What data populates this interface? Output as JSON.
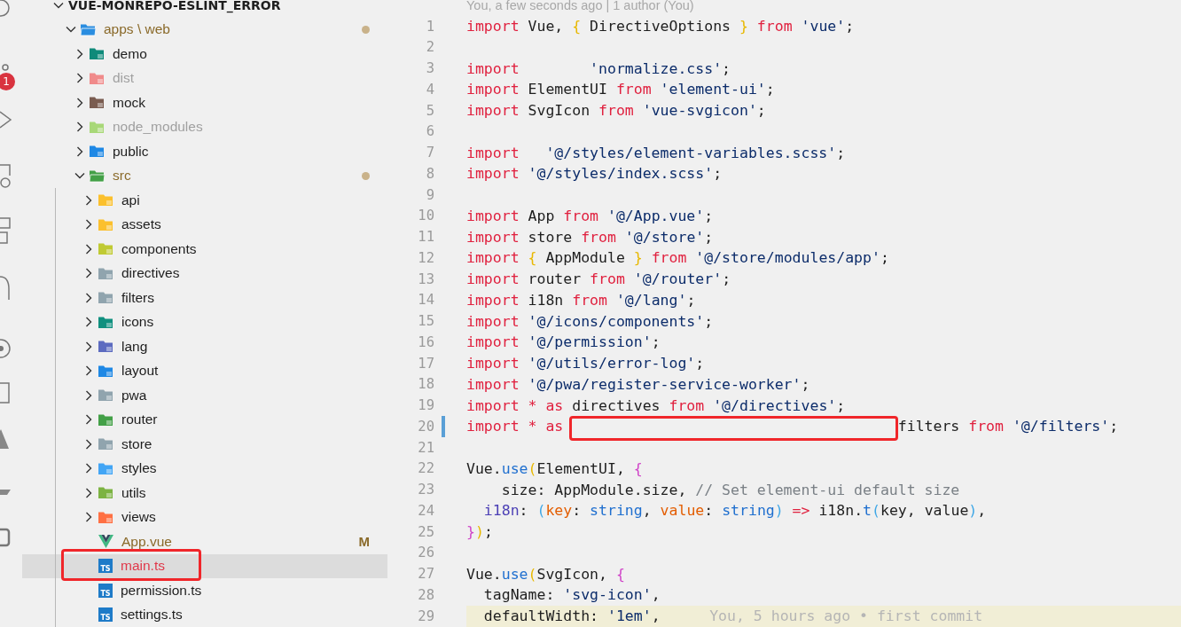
{
  "activity_bar": {
    "badge": "1"
  },
  "explorer": {
    "title": "VUE-MONREPO-ESLINT_ERROR",
    "expanded": true,
    "tree": [
      {
        "label": "apps \\ web",
        "kind": "folder",
        "color": "#2a8de0",
        "expanded": true,
        "modified": true,
        "selected": false,
        "children": [
          {
            "label": "demo",
            "kind": "folder",
            "color": "#0f8a7a",
            "expanded": false,
            "selected": false
          },
          {
            "label": "dist",
            "kind": "folder",
            "color": "#f08a8a",
            "expanded": false,
            "ignored": true,
            "selected": false
          },
          {
            "label": "mock",
            "kind": "folder",
            "color": "#7a5c50",
            "expanded": false,
            "selected": false
          },
          {
            "label": "node_modules",
            "kind": "folder",
            "color": "#a8d878",
            "expanded": false,
            "ignored": true,
            "selected": false
          },
          {
            "label": "public",
            "kind": "folder",
            "color": "#1e88e5",
            "expanded": false,
            "selected": false
          },
          {
            "label": "src",
            "kind": "folder",
            "color": "#43a047",
            "expanded": true,
            "modified": true,
            "selected": false,
            "children": [
              {
                "label": "api",
                "kind": "folder",
                "color": "#fbc02d",
                "expanded": false,
                "selected": false
              },
              {
                "label": "assets",
                "kind": "folder",
                "color": "#fbc02d",
                "expanded": false,
                "selected": false
              },
              {
                "label": "components",
                "kind": "folder",
                "color": "#c0ca33",
                "expanded": false,
                "selected": false
              },
              {
                "label": "directives",
                "kind": "folder",
                "color": "#90a4ae",
                "expanded": false,
                "selected": false
              },
              {
                "label": "filters",
                "kind": "folder",
                "color": "#90a4ae",
                "expanded": false,
                "selected": false
              },
              {
                "label": "icons",
                "kind": "folder",
                "color": "#10907f",
                "expanded": false,
                "selected": false
              },
              {
                "label": "lang",
                "kind": "folder",
                "color": "#5c6bc0",
                "expanded": false,
                "selected": false
              },
              {
                "label": "layout",
                "kind": "folder",
                "color": "#1e88e5",
                "expanded": false,
                "selected": false
              },
              {
                "label": "pwa",
                "kind": "folder",
                "color": "#90a4ae",
                "expanded": false,
                "selected": false
              },
              {
                "label": "router",
                "kind": "folder",
                "color": "#43a047",
                "expanded": false,
                "selected": false
              },
              {
                "label": "store",
                "kind": "folder",
                "color": "#90a4ae",
                "expanded": false,
                "selected": false
              },
              {
                "label": "styles",
                "kind": "folder",
                "color": "#42a5f5",
                "expanded": false,
                "selected": false
              },
              {
                "label": "utils",
                "kind": "folder",
                "color": "#7cb342",
                "expanded": false,
                "selected": false
              },
              {
                "label": "views",
                "kind": "folder",
                "color": "#ff7043",
                "expanded": false,
                "selected": false
              },
              {
                "label": "App.vue",
                "kind": "vue",
                "modified": true,
                "badge": "M",
                "selected": false
              },
              {
                "label": "main.ts",
                "kind": "ts",
                "icon_label": "TS",
                "error": true,
                "selected": true,
                "outlined": true
              },
              {
                "label": "permission.ts",
                "kind": "ts",
                "icon_label": "TS",
                "selected": false
              },
              {
                "label": "settings.ts",
                "kind": "ts",
                "icon_label": "TS",
                "selected": false
              }
            ]
          }
        ]
      }
    ]
  },
  "editor": {
    "blame_header": "You, a few seconds ago | 1 author (You)",
    "lines": [
      {
        "number": "1",
        "tokens": [
          {
            "kind": "kw",
            "text": "import"
          },
          {
            "kind": "pl",
            "text": " Vue, "
          },
          {
            "kind": "br1",
            "text": "{"
          },
          {
            "kind": "pl",
            "text": " DirectiveOptions "
          },
          {
            "kind": "br1",
            "text": "}"
          },
          {
            "kind": "kw",
            "text": " from"
          },
          {
            "kind": "str",
            "text": " 'vue'"
          },
          {
            "kind": "pl",
            "text": ";"
          }
        ]
      },
      {
        "number": "2"
      },
      {
        "number": "3",
        "tokens": [
          {
            "kind": "kw",
            "text": "import"
          },
          {
            "kind": "str",
            "text": "        'normalize.css'"
          },
          {
            "kind": "pl",
            "text": ";"
          }
        ]
      },
      {
        "number": "4",
        "tokens": [
          {
            "kind": "kw",
            "text": "import"
          },
          {
            "kind": "pl",
            "text": " ElementUI "
          },
          {
            "kind": "kw",
            "text": "from"
          },
          {
            "kind": "str",
            "text": " 'element-ui'"
          },
          {
            "kind": "pl",
            "text": ";"
          }
        ]
      },
      {
        "number": "5",
        "tokens": [
          {
            "kind": "kw",
            "text": "import"
          },
          {
            "kind": "pl",
            "text": " SvgIcon "
          },
          {
            "kind": "kw",
            "text": "from"
          },
          {
            "kind": "str",
            "text": " 'vue-svgicon'"
          },
          {
            "kind": "pl",
            "text": ";"
          }
        ]
      },
      {
        "number": "6"
      },
      {
        "number": "7",
        "tokens": [
          {
            "kind": "kw",
            "text": "import"
          },
          {
            "kind": "str",
            "text": "   '@/styles/element-variables.scss'"
          },
          {
            "kind": "pl",
            "text": ";"
          }
        ]
      },
      {
        "number": "8",
        "tokens": [
          {
            "kind": "kw",
            "text": "import"
          },
          {
            "kind": "str",
            "text": " '@/styles/index.scss'"
          },
          {
            "kind": "pl",
            "text": ";"
          }
        ]
      },
      {
        "number": "9"
      },
      {
        "number": "10",
        "tokens": [
          {
            "kind": "kw",
            "text": "import"
          },
          {
            "kind": "pl",
            "text": " App "
          },
          {
            "kind": "kw",
            "text": "from"
          },
          {
            "kind": "str",
            "text": " '@/App.vue'"
          },
          {
            "kind": "pl",
            "text": ";"
          }
        ]
      },
      {
        "number": "11",
        "tokens": [
          {
            "kind": "kw",
            "text": "import"
          },
          {
            "kind": "pl",
            "text": " store "
          },
          {
            "kind": "kw",
            "text": "from"
          },
          {
            "kind": "str",
            "text": " '@/store'"
          },
          {
            "kind": "pl",
            "text": ";"
          }
        ]
      },
      {
        "number": "12",
        "tokens": [
          {
            "kind": "kw",
            "text": "import"
          },
          {
            "kind": "br1",
            "text": " {"
          },
          {
            "kind": "pl",
            "text": " AppModule "
          },
          {
            "kind": "br1",
            "text": "}"
          },
          {
            "kind": "kw",
            "text": " from"
          },
          {
            "kind": "str",
            "text": " '@/store/modules/app'"
          },
          {
            "kind": "pl",
            "text": ";"
          }
        ]
      },
      {
        "number": "13",
        "tokens": [
          {
            "kind": "kw",
            "text": "import"
          },
          {
            "kind": "pl",
            "text": " router "
          },
          {
            "kind": "kw",
            "text": "from"
          },
          {
            "kind": "str",
            "text": " '@/router'"
          },
          {
            "kind": "pl",
            "text": ";"
          }
        ]
      },
      {
        "number": "14",
        "tokens": [
          {
            "kind": "kw",
            "text": "import"
          },
          {
            "kind": "pl",
            "text": " i18n "
          },
          {
            "kind": "kw",
            "text": "from"
          },
          {
            "kind": "str",
            "text": " '@/lang'"
          },
          {
            "kind": "pl",
            "text": ";"
          }
        ]
      },
      {
        "number": "15",
        "tokens": [
          {
            "kind": "kw",
            "text": "import"
          },
          {
            "kind": "str",
            "text": " '@/icons/components'"
          },
          {
            "kind": "pl",
            "text": ";"
          }
        ]
      },
      {
        "number": "16",
        "tokens": [
          {
            "kind": "kw",
            "text": "import"
          },
          {
            "kind": "str",
            "text": " '@/permission'"
          },
          {
            "kind": "pl",
            "text": ";"
          }
        ]
      },
      {
        "number": "17",
        "tokens": [
          {
            "kind": "kw",
            "text": "import"
          },
          {
            "kind": "str",
            "text": " '@/utils/error-log'"
          },
          {
            "kind": "pl",
            "text": ";"
          }
        ]
      },
      {
        "number": "18",
        "tokens": [
          {
            "kind": "kw",
            "text": "import"
          },
          {
            "kind": "str",
            "text": " '@/pwa/register-service-worker'"
          },
          {
            "kind": "pl",
            "text": ";"
          }
        ]
      },
      {
        "number": "19",
        "tokens": [
          {
            "kind": "kw",
            "text": "import * as"
          },
          {
            "kind": "pl",
            "text": " directives "
          },
          {
            "kind": "kw",
            "text": "from"
          },
          {
            "kind": "str",
            "text": " '@/directives'"
          },
          {
            "kind": "pl",
            "text": ";"
          }
        ]
      },
      {
        "number": "20",
        "changed": true,
        "tokens": [
          {
            "kind": "kw",
            "text": "import * as"
          },
          {
            "kind": "gap"
          },
          {
            "kind": "pl",
            "text": "filters "
          },
          {
            "kind": "kw",
            "text": "from"
          },
          {
            "kind": "str",
            "text": " '@/filters'"
          },
          {
            "kind": "pl",
            "text": ";"
          }
        ]
      },
      {
        "number": "21"
      },
      {
        "number": "22",
        "tokens": [
          {
            "kind": "pl",
            "text": "Vue."
          },
          {
            "kind": "fn",
            "text": "use"
          },
          {
            "kind": "br1",
            "text": "("
          },
          {
            "kind": "pl",
            "text": "ElementUI, "
          },
          {
            "kind": "br2",
            "text": "{"
          }
        ]
      },
      {
        "number": "23",
        "tokens": [
          {
            "kind": "pl",
            "text": "    size: AppModule.size, "
          },
          {
            "kind": "cm",
            "text": "// Set element-ui default size"
          }
        ]
      },
      {
        "number": "24",
        "tokens": [
          {
            "kind": "prop",
            "text": "  i18n"
          },
          {
            "kind": "pl",
            "text": ": "
          },
          {
            "kind": "br3",
            "text": "("
          },
          {
            "kind": "param",
            "text": "key"
          },
          {
            "kind": "pl",
            "text": ": "
          },
          {
            "kind": "type",
            "text": "string"
          },
          {
            "kind": "pl",
            "text": ", "
          },
          {
            "kind": "param",
            "text": "value"
          },
          {
            "kind": "pl",
            "text": ": "
          },
          {
            "kind": "type",
            "text": "string"
          },
          {
            "kind": "br3",
            "text": ")"
          },
          {
            "kind": "op",
            "text": " =>"
          },
          {
            "kind": "pl",
            "text": " i18n."
          },
          {
            "kind": "fn",
            "text": "t"
          },
          {
            "kind": "br3",
            "text": "("
          },
          {
            "kind": "pl",
            "text": "key, value"
          },
          {
            "kind": "br3",
            "text": ")"
          },
          {
            "kind": "pl",
            "text": ","
          }
        ]
      },
      {
        "number": "25",
        "tokens": [
          {
            "kind": "br2",
            "text": "}"
          },
          {
            "kind": "br1",
            "text": ")"
          },
          {
            "kind": "pl",
            "text": ";"
          }
        ]
      },
      {
        "number": "26"
      },
      {
        "number": "27",
        "tokens": [
          {
            "kind": "pl",
            "text": "Vue."
          },
          {
            "kind": "fn",
            "text": "use"
          },
          {
            "kind": "br1",
            "text": "("
          },
          {
            "kind": "pl",
            "text": "SvgIcon, "
          },
          {
            "kind": "br2",
            "text": "{"
          }
        ]
      },
      {
        "number": "28",
        "tokens": [
          {
            "kind": "pl",
            "text": "  tagName: "
          },
          {
            "kind": "str",
            "text": "'svg-icon'"
          },
          {
            "kind": "pl",
            "text": ","
          }
        ]
      },
      {
        "number": "29",
        "current": true,
        "blame": "You, 5 hours ago • first commit",
        "tokens": [
          {
            "kind": "pl",
            "text": "  defaultWidth: "
          },
          {
            "kind": "str",
            "text": "'1em'"
          },
          {
            "kind": "pl",
            "text": ","
          }
        ]
      }
    ]
  }
}
